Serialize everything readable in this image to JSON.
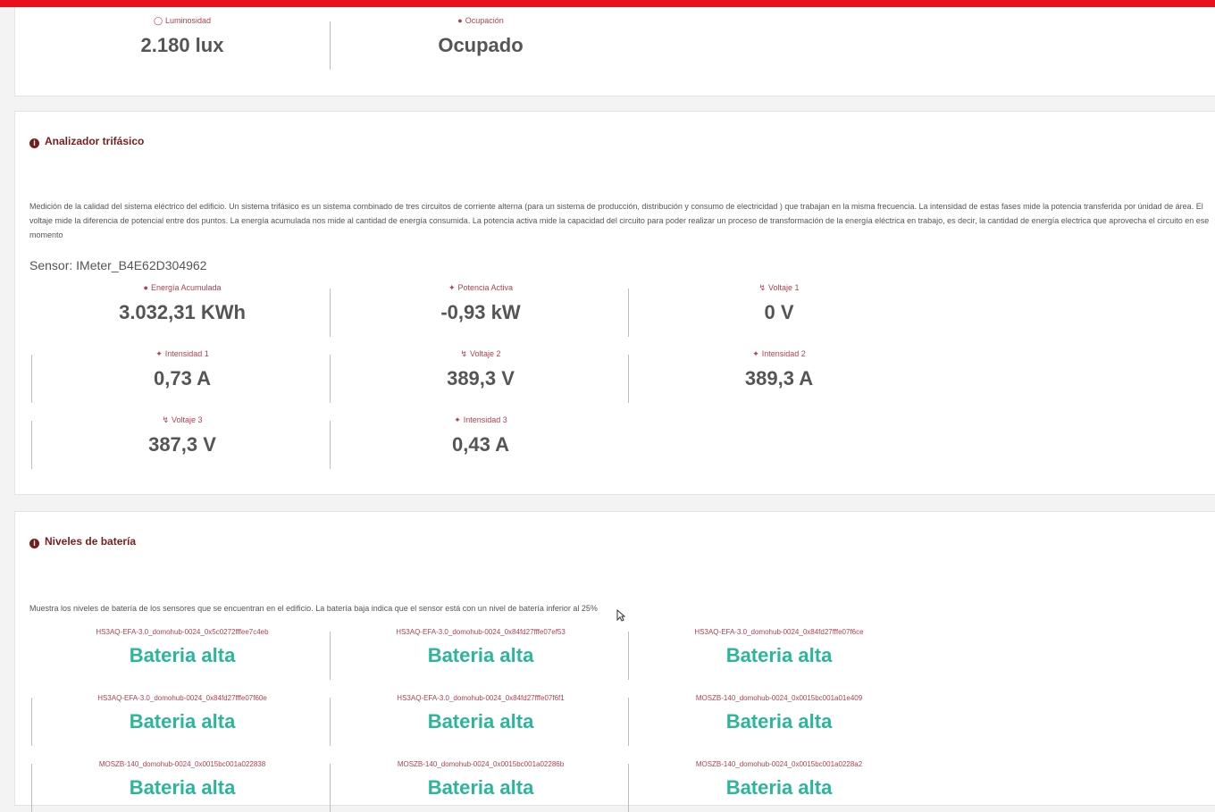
{
  "colors": {
    "accent": "#e8101a",
    "label": "#b04050",
    "title": "#7a1a1a",
    "battery_ok": "#2bb59a"
  },
  "top_card": {
    "metrics": [
      {
        "icon": "lightbulb-icon",
        "label": "Luminosidad",
        "value": "2.180 lux"
      },
      {
        "icon": "user-icon",
        "label": "Ocupación",
        "value": "Ocupado"
      }
    ]
  },
  "analyzer": {
    "title": "Analizador trifásico",
    "description": "Medición de la calidad del sistema eléctrico del edificio. Un sistema trifásico es un sistema combinado de tres circuitos de corriente alterna (para un sistema de producción, distribución y consumo de electricidad ) que trabajan en la misma frecuencia. La intensidad de estas fases mide la potencia transferida por únidad de área. El voltaje mide la diferencia de potencial entre dos puntos. La energía acumulada nos mide al cantidad de energía consumida. La potencia activa mide la capacidad del circuito para poder realizar un proceso de transformación de la energía eléctrica en trabajo, es decir, la cantidad de energía electrica que aprovecha el circuito en ese momento",
    "sensor": "Sensor: IMeter_B4E62D304962",
    "metrics": [
      {
        "icon": "user-icon",
        "label": "Energía Acumulada",
        "value": "3.032,31 KWh"
      },
      {
        "icon": "plug-icon",
        "label": "Potencia Activa",
        "value": "-0,93 kW"
      },
      {
        "icon": "bolt-icon",
        "label": "Voltaje 1",
        "value": "0 V"
      },
      {
        "icon": "plug-icon",
        "label": "Intensidad 1",
        "value": "0,73 A"
      },
      {
        "icon": "bolt-icon",
        "label": "Voltaje 2",
        "value": "389,3 V"
      },
      {
        "icon": "plug-icon",
        "label": "Intensidad 2",
        "value": "389,3 A"
      },
      {
        "icon": "bolt-icon",
        "label": "Voltaje 3",
        "value": "387,3 V"
      },
      {
        "icon": "plug-icon",
        "label": "Intensidad 3",
        "value": "0,43 A"
      }
    ]
  },
  "battery": {
    "title": "Niveles de batería",
    "description": "Muestra los niveles de batería de los sensores que se encuentran en el edificio. La batería baja indica que el sensor está con un nivel de batería inferior al 25%",
    "items": [
      {
        "label": "HS3AQ-EFA-3.0_domohub-0024_0x5c0272fffee7c4eb",
        "value": "Bateria alta"
      },
      {
        "label": "HS3AQ-EFA-3.0_domohub-0024_0x84fd27fffe07ef53",
        "value": "Bateria alta"
      },
      {
        "label": "HS3AQ-EFA-3.0_domohub-0024_0x84fd27fffe07f6ce",
        "value": "Bateria alta"
      },
      {
        "label": "HS3AQ-EFA-3.0_domohub-0024_0x84fd27fffe07f60e",
        "value": "Bateria alta"
      },
      {
        "label": "HS3AQ-EFA-3.0_domohub-0024_0x84fd27fffe07f6f1",
        "value": "Bateria alta"
      },
      {
        "label": "MOSZB-140_domohub-0024_0x0015bc001a01e409",
        "value": "Bateria alta"
      },
      {
        "label": "MOSZB-140_domohub-0024_0x0015bc001a022838",
        "value": "Bateria alta"
      },
      {
        "label": "MOSZB-140_domohub-0024_0x0015bc001a02286b",
        "value": "Bateria alta"
      },
      {
        "label": "MOSZB-140_domohub-0024_0x0015bc001a0228a2",
        "value": "Bateria alta"
      }
    ]
  }
}
